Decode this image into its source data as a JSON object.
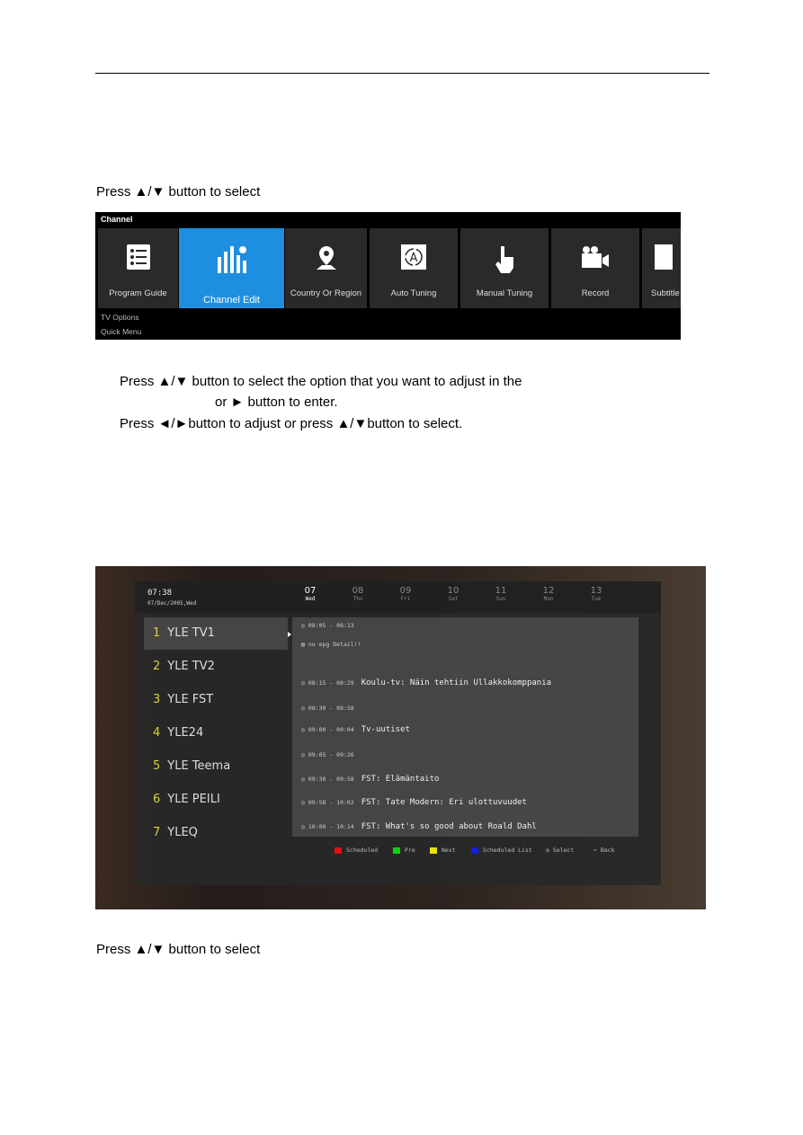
{
  "doc": {
    "line1": "Press ▲/▼ button to select",
    "line2": "Press ▲/▼ button to select the option that you want to adjust in the",
    "line3": "or ► button to enter.",
    "line4": "Press ◄/►button to adjust or press ▲/▼button to select.",
    "line5": "Press ▲/▼ button to select"
  },
  "channel_menu": {
    "title": "Channel",
    "tiles": [
      {
        "label": "Program Guide",
        "icon": "list-icon"
      },
      {
        "label": "Channel Edit",
        "icon": "bars-gear-icon",
        "selected": true
      },
      {
        "label": "Country Or Region",
        "icon": "location-pin-icon"
      },
      {
        "label": "Auto Tuning",
        "icon": "auto-a-icon"
      },
      {
        "label": "Manual Tuning",
        "icon": "hand-pointer-icon"
      },
      {
        "label": "Record",
        "icon": "video-camera-icon"
      },
      {
        "label": "Subtitle",
        "icon": "subtitle-icon"
      }
    ],
    "sub1": "TV Options",
    "sub2": "Quick Menu",
    "accent": "#1e8fe0"
  },
  "epg": {
    "time": "07:38",
    "date": "07/Dec/2005,Wed",
    "days": [
      {
        "n": "07",
        "w": "Wed"
      },
      {
        "n": "08",
        "w": "Thu"
      },
      {
        "n": "09",
        "w": "Fri"
      },
      {
        "n": "10",
        "w": "Sat"
      },
      {
        "n": "11",
        "w": "Sun"
      },
      {
        "n": "12",
        "w": "Mon"
      },
      {
        "n": "13",
        "w": "Tue"
      }
    ],
    "channels": [
      {
        "num": "1",
        "name": "YLE TV1"
      },
      {
        "num": "2",
        "name": "YLE TV2"
      },
      {
        "num": "3",
        "name": "YLE FST"
      },
      {
        "num": "4",
        "name": "YLE24"
      },
      {
        "num": "5",
        "name": "YLE Teema"
      },
      {
        "num": "6",
        "name": "YLE PEILI"
      },
      {
        "num": "7",
        "name": "YLEQ"
      }
    ],
    "programs": [
      {
        "time": "08:05 - 08:13",
        "title": ""
      },
      {
        "time": "08:15 - 08:29",
        "title": "Koulu-tv: Näin tehtiin Ullakkokomppania"
      },
      {
        "time": "08:30 - 08:58",
        "title": ""
      },
      {
        "time": "09:00 - 09:04",
        "title": "Tv-uutiset"
      },
      {
        "time": "09:05 - 09:26",
        "title": ""
      },
      {
        "time": "09:30 - 09:58",
        "title": "FST: Elämäntaito"
      },
      {
        "time": "09:58 - 10:02",
        "title": "FST: Tate Modern: Eri ulottuvuudet"
      },
      {
        "time": "10:00 - 10:14",
        "title": "FST: What's so good about Roald Dahl"
      }
    ],
    "detail": "no epg Detail!!",
    "legend": {
      "red": "Scheduled",
      "green": "Pre",
      "yellow": "Next",
      "blue": "Scheduled List",
      "select": "Select",
      "back": "Back"
    }
  }
}
